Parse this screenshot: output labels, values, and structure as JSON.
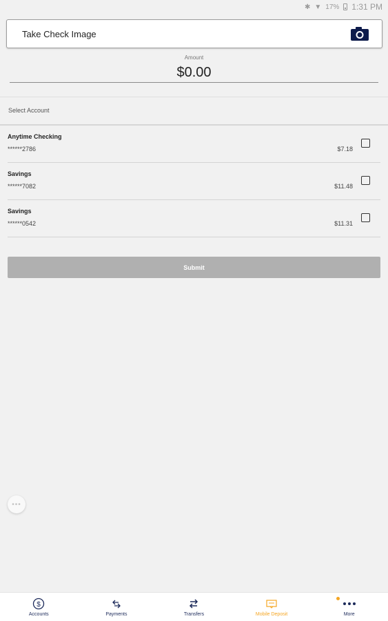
{
  "status_bar": {
    "time": "1:31 PM",
    "battery_text": "17%",
    "icons": [
      "bluetooth-icon",
      "wifi-icon",
      "battery-icon"
    ]
  },
  "take_check": {
    "label": "Take Check Image",
    "icon": "camera-icon",
    "icon_color": "#0d1b4b"
  },
  "amount": {
    "caption": "Amount",
    "value": "$0.00"
  },
  "select_account_label": "Select Account",
  "accounts": [
    {
      "name": "Anytime Checking",
      "number": "******2786",
      "balance": "$7.18",
      "checked": false
    },
    {
      "name": "Savings",
      "number": "******7082",
      "balance": "$11.48",
      "checked": false
    },
    {
      "name": "Savings",
      "number": "******0542",
      "balance": "$11.31",
      "checked": false
    }
  ],
  "submit_label": "Submit",
  "floating_button": "•••",
  "nav": {
    "items": [
      {
        "label": "Accounts",
        "icon": "dollar-circle-icon"
      },
      {
        "label": "Payments",
        "icon": "payments-arrows-icon"
      },
      {
        "label": "Transfers",
        "icon": "transfer-arrows-icon"
      },
      {
        "label": "Mobile Deposit",
        "icon": "mobile-deposit-icon",
        "active": true
      },
      {
        "label": "More",
        "icon": "more-dots-icon"
      }
    ],
    "active_color": "#f5a623",
    "default_color": "#1c2a5a"
  }
}
